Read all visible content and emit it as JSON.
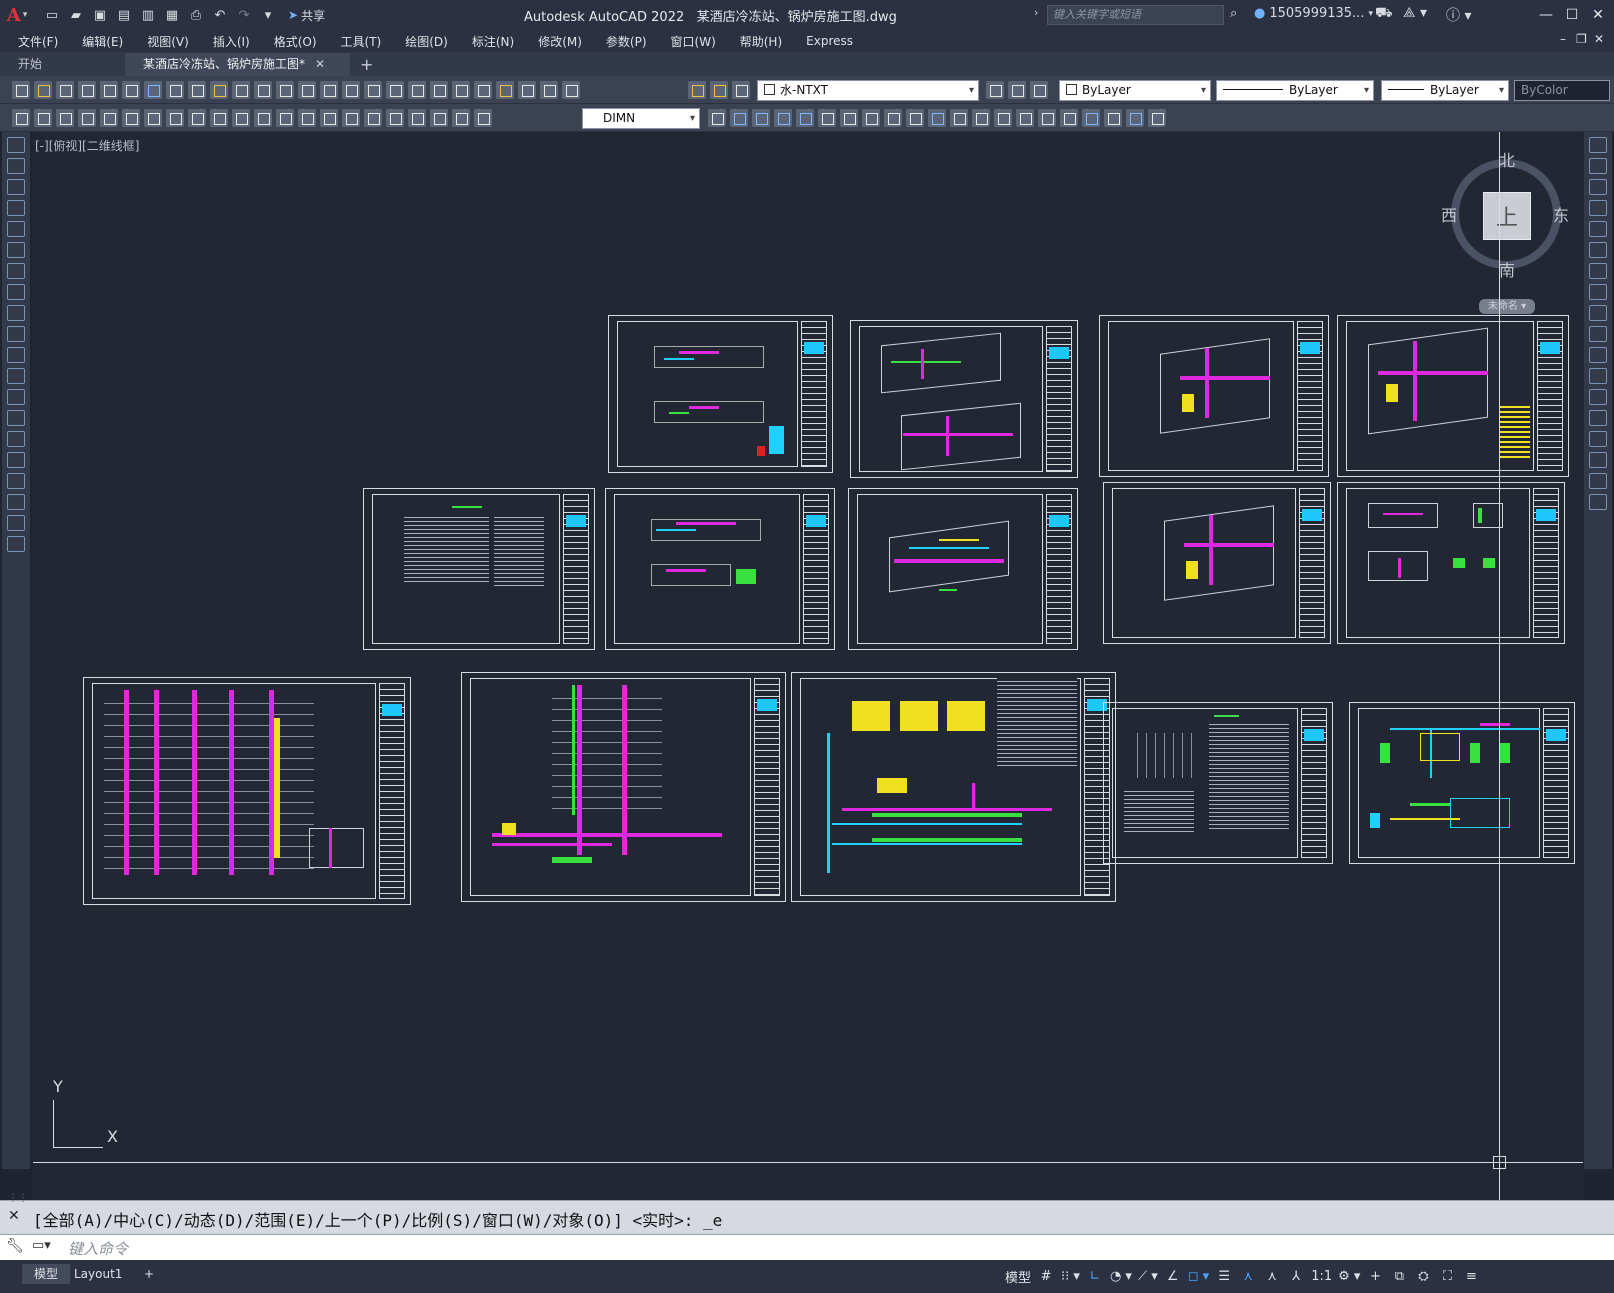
{
  "app": {
    "title": "Autodesk AutoCAD 2022",
    "filename": "某酒店冷冻站、锅炉房施工图.dwg",
    "logo": "A"
  },
  "qat": {
    "share_label": "共享",
    "icons": [
      "new-icon",
      "open-icon",
      "save-icon",
      "saveas-icon",
      "plot-icon",
      "undo-icon",
      "redo-icon",
      "dropdown-icon",
      "share-icon"
    ]
  },
  "search": {
    "placeholder": "键入关键字或短语"
  },
  "user": {
    "name": "1505999135..."
  },
  "menu": [
    "文件(F)",
    "编辑(E)",
    "视图(V)",
    "插入(I)",
    "格式(O)",
    "工具(T)",
    "绘图(D)",
    "标注(N)",
    "修改(M)",
    "参数(P)",
    "窗口(W)",
    "帮助(H)",
    "Express"
  ],
  "tabs": {
    "start": "开始",
    "active": "某酒店冷冻站、锅炉房施工图*",
    "add": "+"
  },
  "toolbar": {
    "layer": "水-NTXT",
    "color": "ByLayer",
    "linetype": "ByLayer",
    "lineweight": "ByLayer",
    "plotstyle": "ByColor",
    "dimstyle": "DIMN"
  },
  "viewport": {
    "label": "[-][俯视][二维线框]"
  },
  "viewcube": {
    "top": "上",
    "north": "北",
    "south": "南",
    "east": "东",
    "west": "西",
    "wcs": "未命名"
  },
  "ucs": {
    "x": "X",
    "y": "Y"
  },
  "command": {
    "history": "[全部(A)/中心(C)/动态(D)/范围(E)/上一个(P)/比例(S)/窗口(W)/对象(O)] <实时>: _e",
    "placeholder": "键入命令"
  },
  "status": {
    "model_tab": "模型",
    "layout_tab": "Layout1",
    "add": "+",
    "model_label": "模型",
    "scale": "1:1"
  },
  "colors": {
    "accent": "#4aa3ff",
    "magenta": "#e028e0",
    "cyan": "#20d0ff",
    "green": "#38e040",
    "yellow": "#f0e020"
  }
}
